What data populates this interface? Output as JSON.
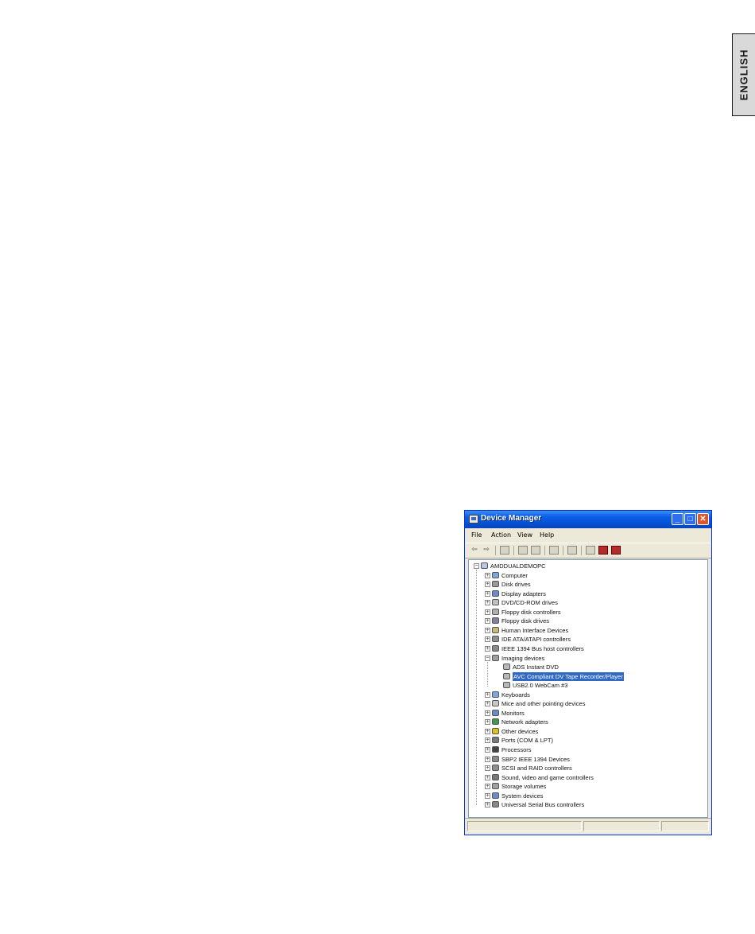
{
  "side_tab": {
    "label": "ENGLISH"
  },
  "window": {
    "title": "Device Manager",
    "menu": [
      "File",
      "Action",
      "View",
      "Help"
    ],
    "root": "AMDDUALDEMOPC",
    "categories": [
      "Computer",
      "Disk drives",
      "Display adapters",
      "DVD/CD-ROM drives",
      "Floppy disk controllers",
      "Floppy disk drives",
      "Human Interface Devices",
      "IDE ATA/ATAPI controllers",
      "IEEE 1394 Bus host controllers",
      "Imaging devices",
      "Keyboards",
      "Mice and other pointing devices",
      "Monitors",
      "Network adapters",
      "Other devices",
      "Ports (COM & LPT)",
      "Processors",
      "SBP2 IEEE 1394 Devices",
      "SCSI and RAID controllers",
      "Sound, video and game controllers",
      "Storage volumes",
      "System devices",
      "Universal Serial Bus controllers"
    ],
    "imaging_children": [
      "ADS Instant DVD",
      "AVC Compliant DV Tape Recorder/Player",
      "USB2.0 WebCam #3"
    ],
    "selected_item": "AVC Compliant DV Tape Recorder/Player"
  },
  "colors": {
    "titlebar": "#0a5ee6",
    "selection": "#316ac5",
    "window_bg": "#ece9d8"
  }
}
